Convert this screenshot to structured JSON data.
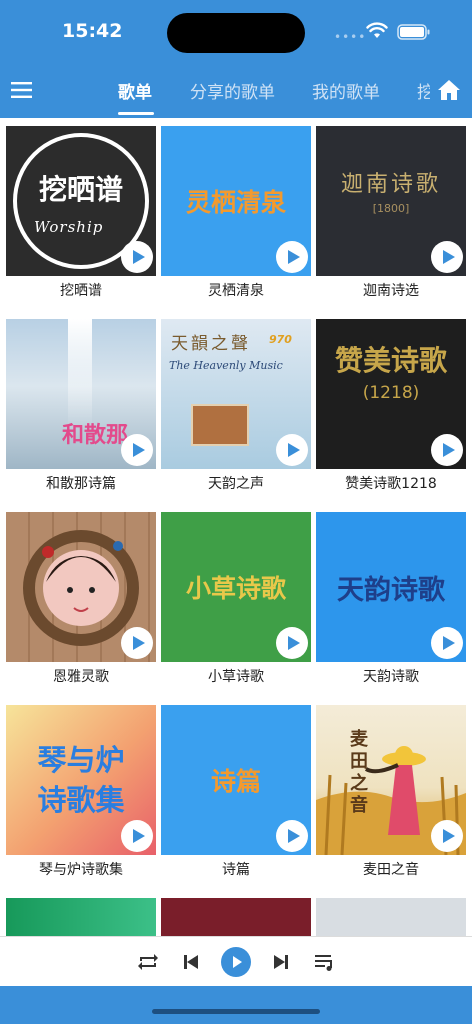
{
  "status": {
    "time": "15:42",
    "dots": "••••"
  },
  "tabs": [
    {
      "label": "歌单",
      "active": true
    },
    {
      "label": "分享的歌单",
      "active": false
    },
    {
      "label": "我的歌单",
      "active": false
    },
    {
      "label": "挖",
      "active": false
    }
  ],
  "cover_texts": {
    "wasai": "挖晒谱",
    "wasai_sub": "Worship",
    "lingqi": "灵栖清泉",
    "jianan": "迦南诗歌",
    "jianan_sub": "[1800]",
    "hesanna": "和散那",
    "tianyun_title": "天韻之聲",
    "tianyun_badge": "970",
    "tianyun_en": "The Heavenly Music",
    "zanmei": "赞美诗歌",
    "zanmei_num": "(1218)",
    "xiaocao": "小草诗歌",
    "tianyunsg": "天韵诗歌",
    "qinyulu": "琴与炉\n诗歌集",
    "shipian": "诗篇",
    "maitian": "麦田之音"
  },
  "songbooks": [
    {
      "title": "挖晒谱",
      "color": "#2c2c2c"
    },
    {
      "title": "灵栖清泉",
      "color": "#3aa0ef"
    },
    {
      "title": "迦南诗选",
      "color": "#2b2d33"
    },
    {
      "title": "和散那诗篇",
      "color": "#c9d6df"
    },
    {
      "title": "天韵之声",
      "color": "#8fc5d8"
    },
    {
      "title": "赞美诗歌1218",
      "color": "#1e1e1e"
    },
    {
      "title": "恩雅灵歌",
      "color": "#b48a6a"
    },
    {
      "title": "小草诗歌",
      "color": "#3f9f47"
    },
    {
      "title": "天韵诗歌",
      "color": "#2d96ec"
    },
    {
      "title": "琴与炉诗歌集",
      "color": "#f0c080"
    },
    {
      "title": "诗篇",
      "color": "#3aa0ef"
    },
    {
      "title": "麦田之音",
      "color": "#e8d8a0"
    }
  ],
  "player": {
    "buttons": [
      "repeat-icon",
      "previous-icon",
      "play-icon",
      "next-icon",
      "playlist-icon"
    ]
  },
  "colors": {
    "accent": "#3a8fd9",
    "caption": "#222222"
  }
}
